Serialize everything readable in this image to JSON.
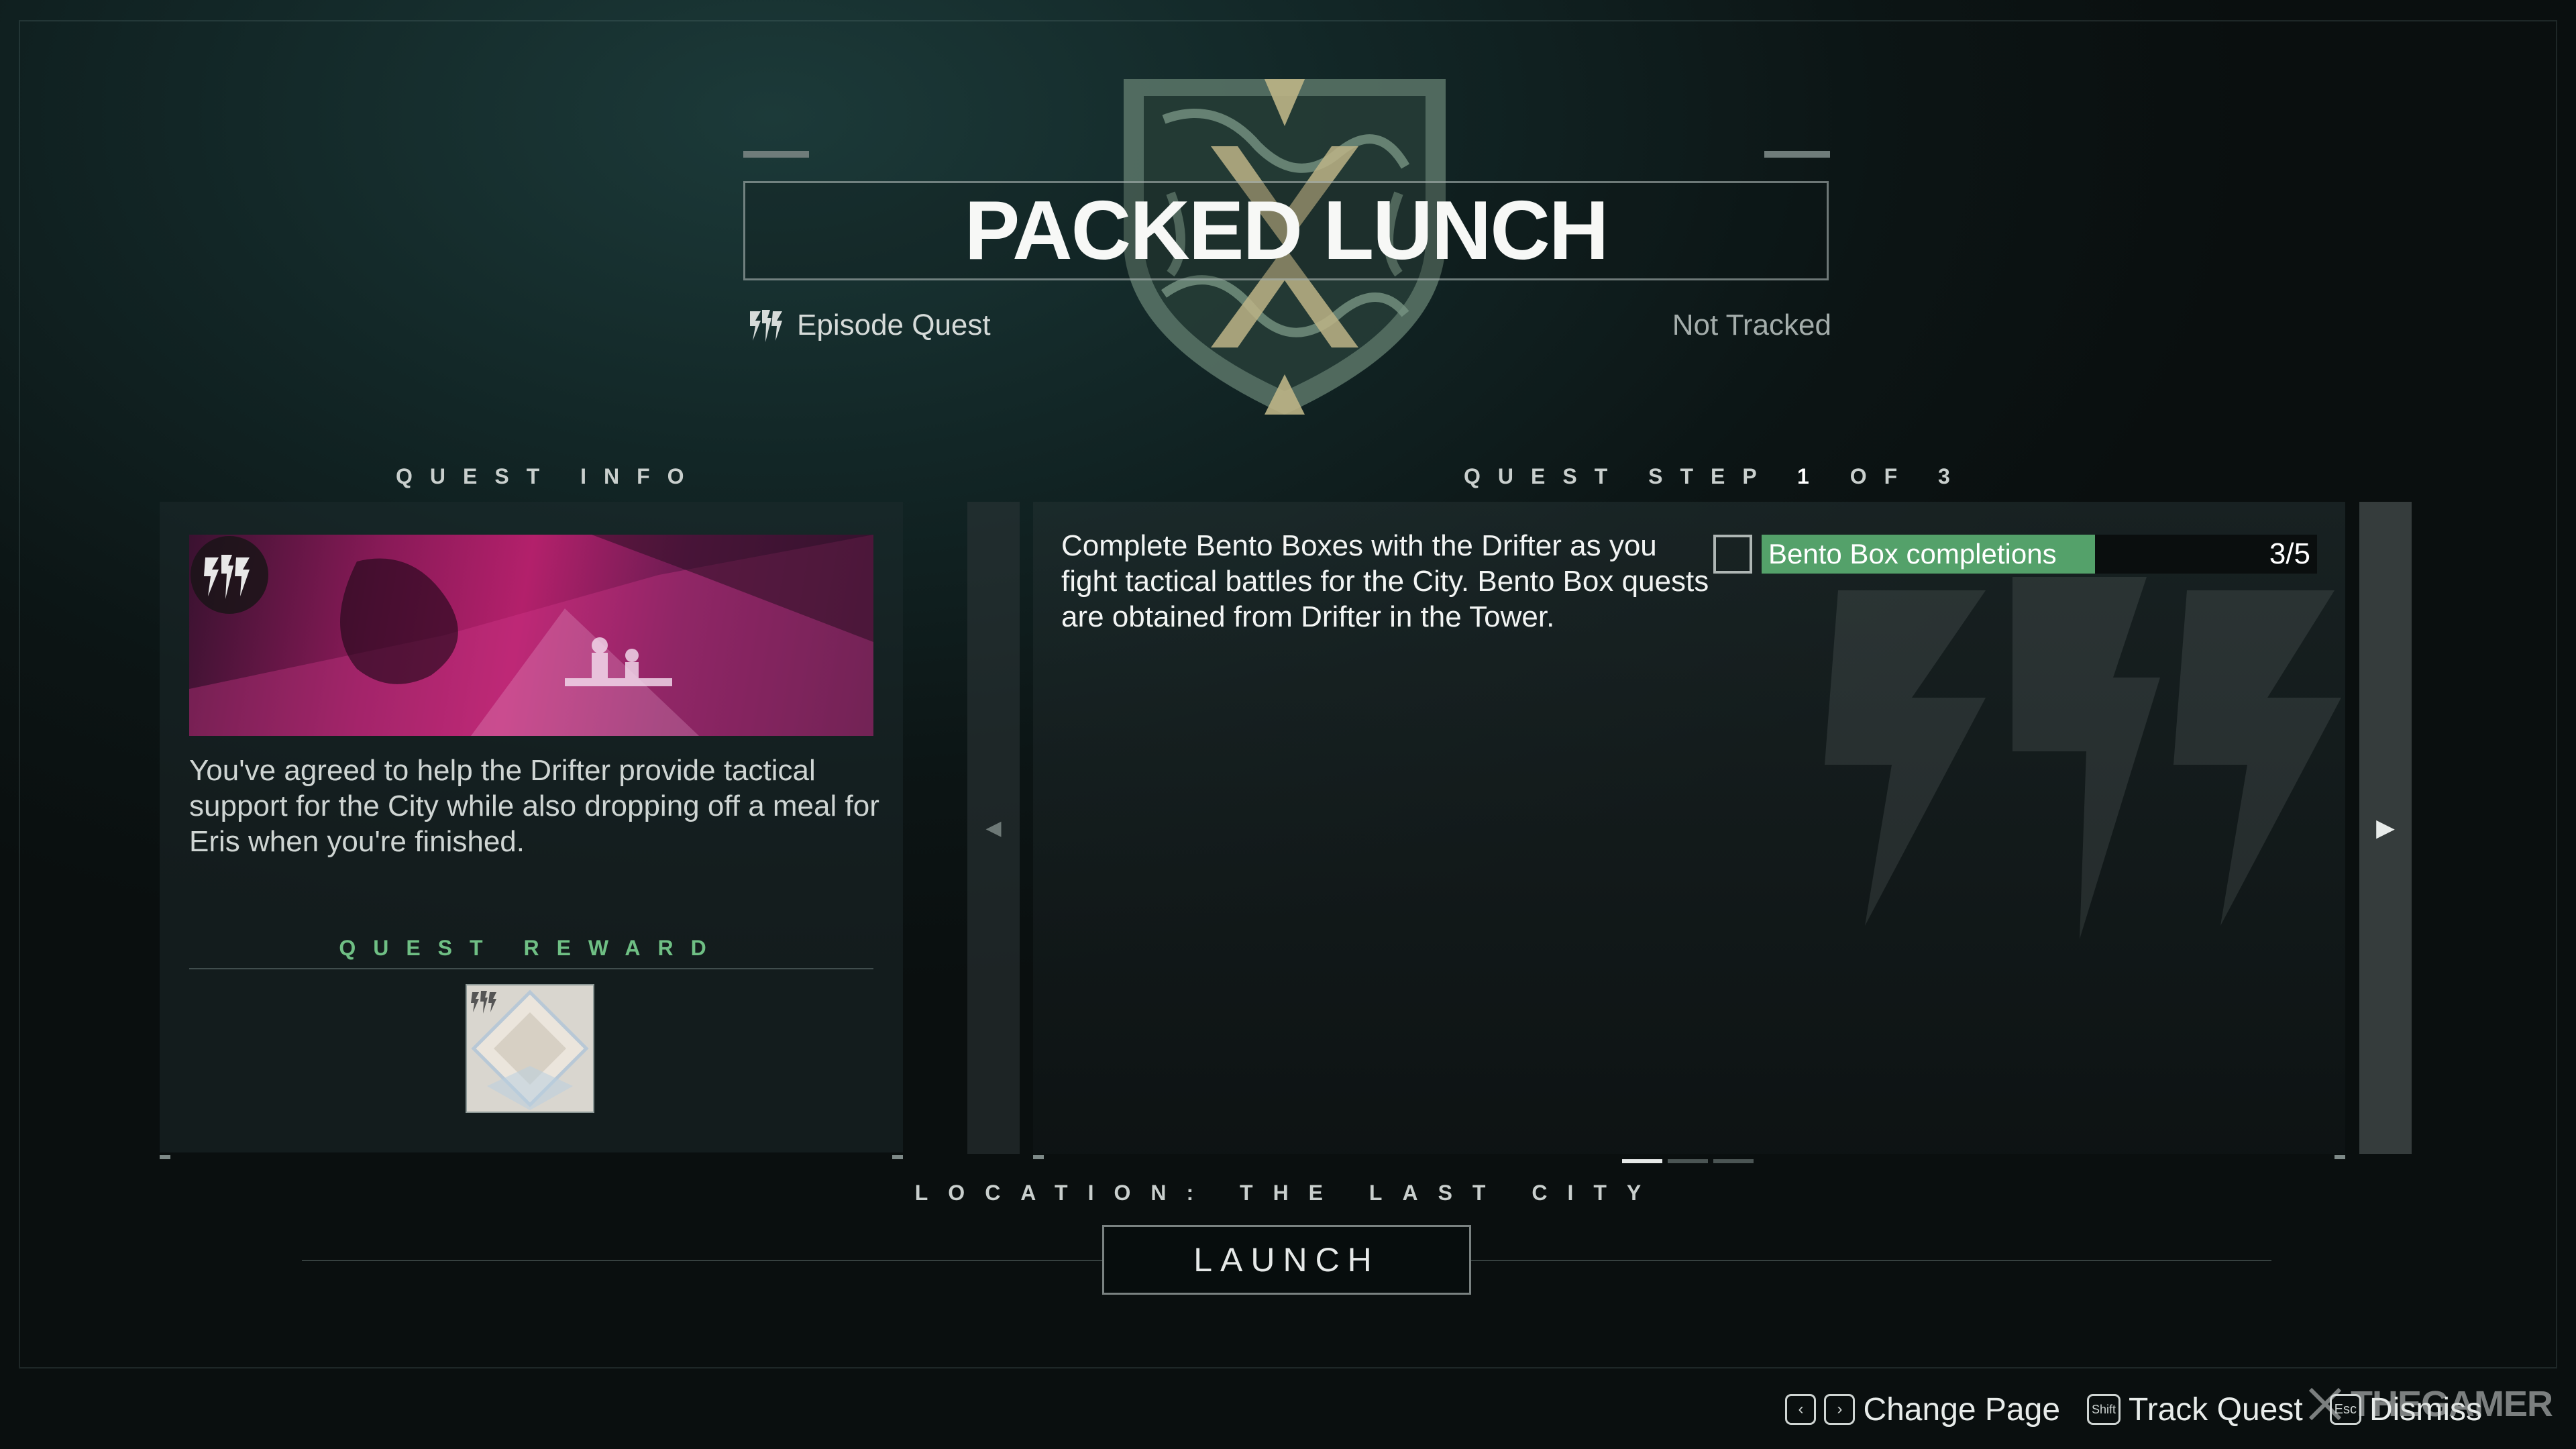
{
  "header": {
    "title": "PACKED LUNCH",
    "quest_type": "Episode Quest",
    "tracking_status": "Not Tracked"
  },
  "quest_info": {
    "section_label": "QUEST INFO",
    "description": "You've agreed to help the Drifter provide tactical support for the City while also dropping off a meal for Eris when you're finished.",
    "reward_label": "QUEST REWARD"
  },
  "quest_step": {
    "section_label_prefix": "QUEST STEP",
    "current": "1",
    "of_label": "OF",
    "total": "3",
    "description": "Complete Bento Boxes with the Drifter as you fight tactical battles for the City. Bento Box quests are obtained from Drifter in the Tower.",
    "objective": {
      "label": "Bento Box completions",
      "count": "3/5",
      "progress": 0.6
    },
    "pages": 3,
    "active_page": 0
  },
  "location": "LOCATION: THE LAST CITY",
  "launch_label": "LAUNCH",
  "footer": {
    "change_page": "Change Page",
    "track_quest": "Track Quest",
    "track_key": "Shift",
    "dismiss": "Dismiss",
    "dismiss_key": "Esc"
  },
  "brand": "THEGAMER",
  "colors": {
    "objective_fill": "#54a16a",
    "reward_label": "#6fbf84",
    "background": "#0d1414"
  },
  "icons": [
    "crest-emblem",
    "episode-quest-icon",
    "chevron-left-icon",
    "chevron-right-icon",
    "key-left-icon",
    "key-right-icon"
  ]
}
